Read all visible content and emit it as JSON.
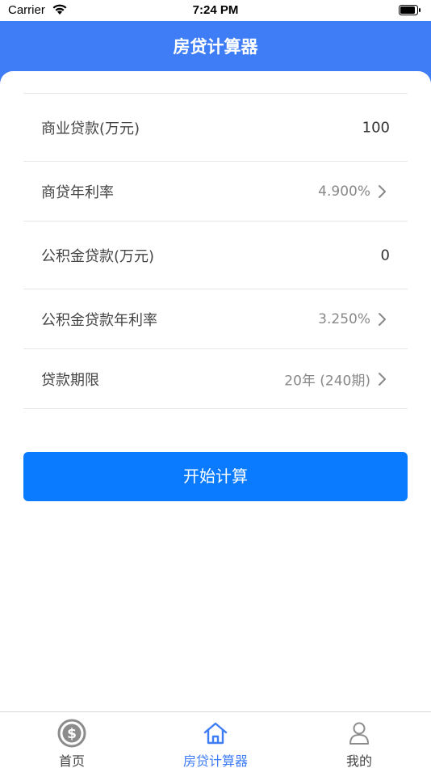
{
  "status_bar": {
    "carrier": "Carrier",
    "time": "7:24 PM"
  },
  "nav": {
    "title": "房贷计算器"
  },
  "form": {
    "commercial_loan": {
      "label": "商业贷款(万元)",
      "value": "100"
    },
    "commercial_rate": {
      "label": "商贷年利率",
      "value": "4.900%"
    },
    "fund_loan": {
      "label": "公积金贷款(万元)",
      "value": "0"
    },
    "fund_rate": {
      "label": "公积金贷款年利率",
      "value": "3.250%"
    },
    "loan_term": {
      "label": "贷款期限",
      "value": "20年 (240期)"
    }
  },
  "calc_button": {
    "label": "开始计算"
  },
  "tabbar": {
    "items": [
      {
        "label": "首页",
        "icon": "dollar-circle-icon"
      },
      {
        "label": "房贷计算器",
        "icon": "home-icon",
        "active": true
      },
      {
        "label": "我的",
        "icon": "user-icon"
      }
    ]
  },
  "colors": {
    "brand": "#3f7df6",
    "button": "#0a7bff"
  }
}
